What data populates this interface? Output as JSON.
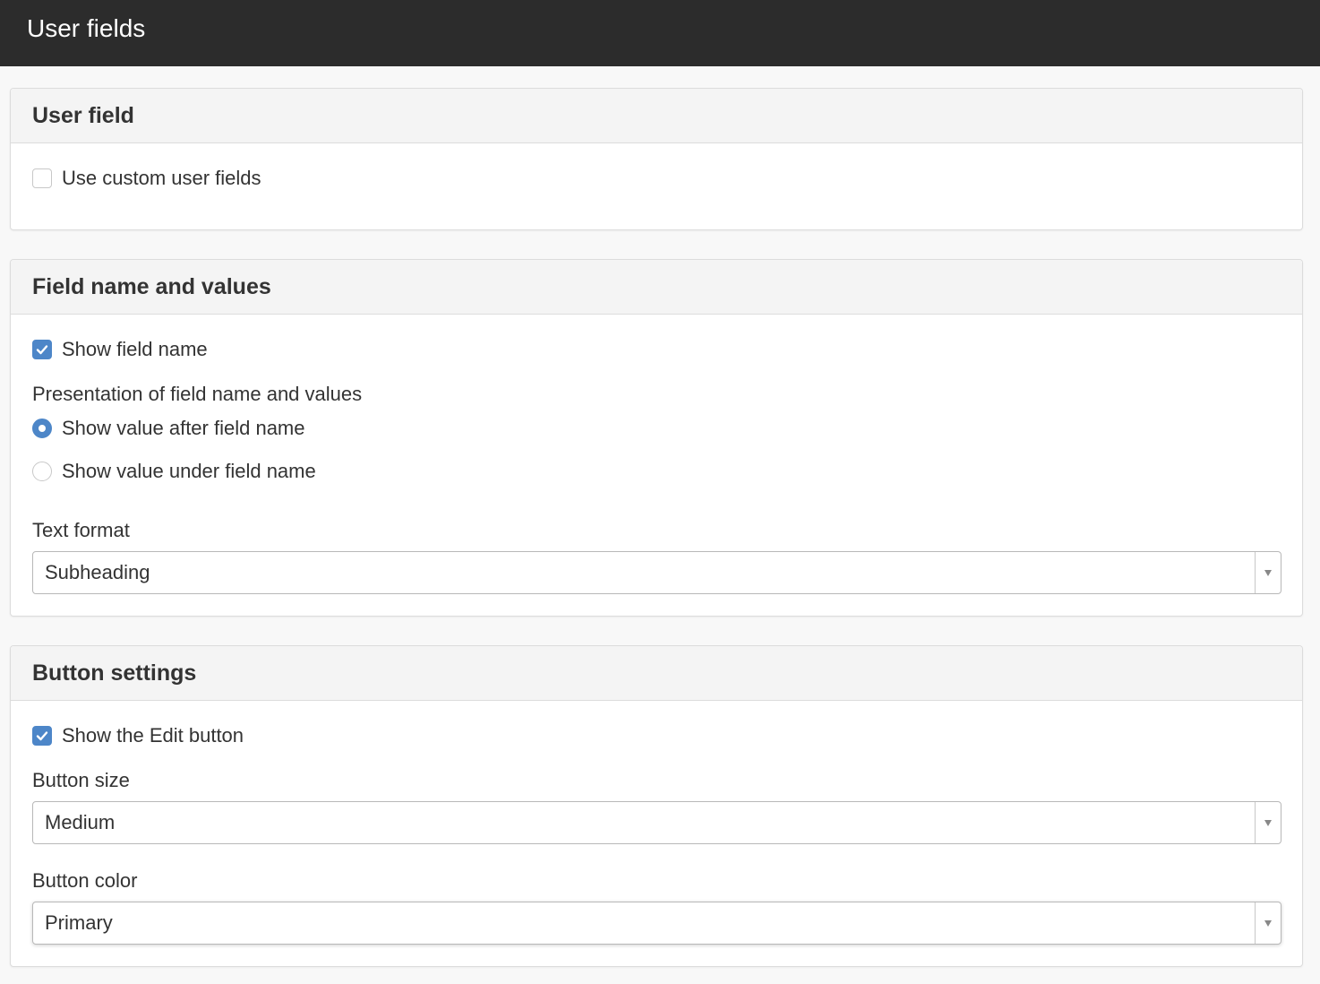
{
  "header": {
    "title": "User fields"
  },
  "user_field": {
    "heading": "User field",
    "use_custom_label": "Use custom user fields",
    "use_custom_checked": false
  },
  "field_name": {
    "heading": "Field name and values",
    "show_field_name_label": "Show field name",
    "show_field_name_checked": true,
    "presentation_label": "Presentation of field name and values",
    "presentation_options": [
      {
        "label": "Show value after field name",
        "selected": true
      },
      {
        "label": "Show value under field name",
        "selected": false
      }
    ],
    "text_format_label": "Text format",
    "text_format_value": "Subheading"
  },
  "button_settings": {
    "heading": "Button settings",
    "show_edit_label": "Show the Edit button",
    "show_edit_checked": true,
    "size_label": "Button size",
    "size_value": "Medium",
    "color_label": "Button color",
    "color_value": "Primary"
  },
  "colors": {
    "topbar": "#2c2c2c",
    "accent": "#4d86c8",
    "page_background": "#f8f8f8"
  }
}
